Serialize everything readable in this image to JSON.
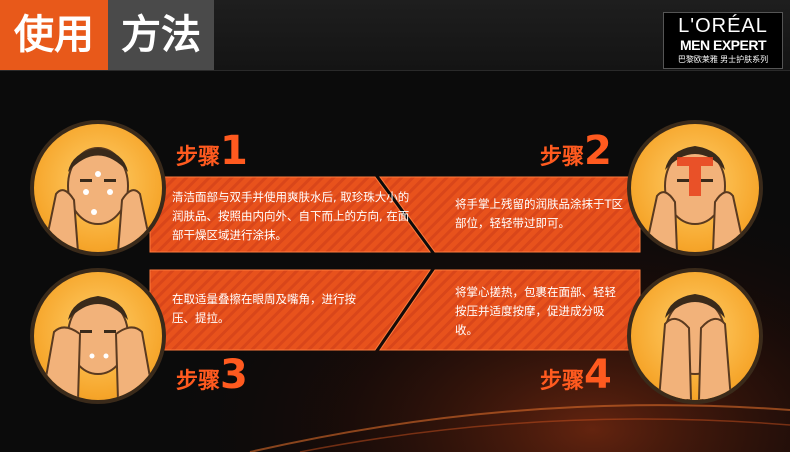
{
  "header": {
    "title_part1": "使用",
    "title_part2": "方法"
  },
  "brand": {
    "logo_line1": "L'ORÉAL",
    "logo_line2": "MEN EXPERT",
    "logo_line3": "巴黎欧莱雅 男士护肤系列"
  },
  "steps": [
    {
      "word": "步骤",
      "num": "1",
      "text": "清洁面部与双手并使用爽肤水后, 取珍珠大小的润肤品、按照由内向外、自下而上的方向, 在面部干燥区域进行涂抹。"
    },
    {
      "word": "步骤",
      "num": "2",
      "text": "将手掌上残留的润肤品涂抹于T区部位，轻轻带过即可。"
    },
    {
      "word": "步骤",
      "num": "3",
      "text": "在取适量叠擦在眼周及嘴角，进行按压、提拉。"
    },
    {
      "word": "步骤",
      "num": "4",
      "text": "将掌心搓热，包裹在面部、轻轻按压并适度按摩，促进成分吸收。"
    }
  ],
  "colors": {
    "accent": "#e8591a",
    "banner": "#e8521c",
    "step_label": "#ff5a1f",
    "face": "#f6a52a"
  },
  "icons": [
    "face-applying-cream-icon",
    "face-t-zone-icon",
    "face-eye-press-icon",
    "face-palms-cover-icon"
  ]
}
